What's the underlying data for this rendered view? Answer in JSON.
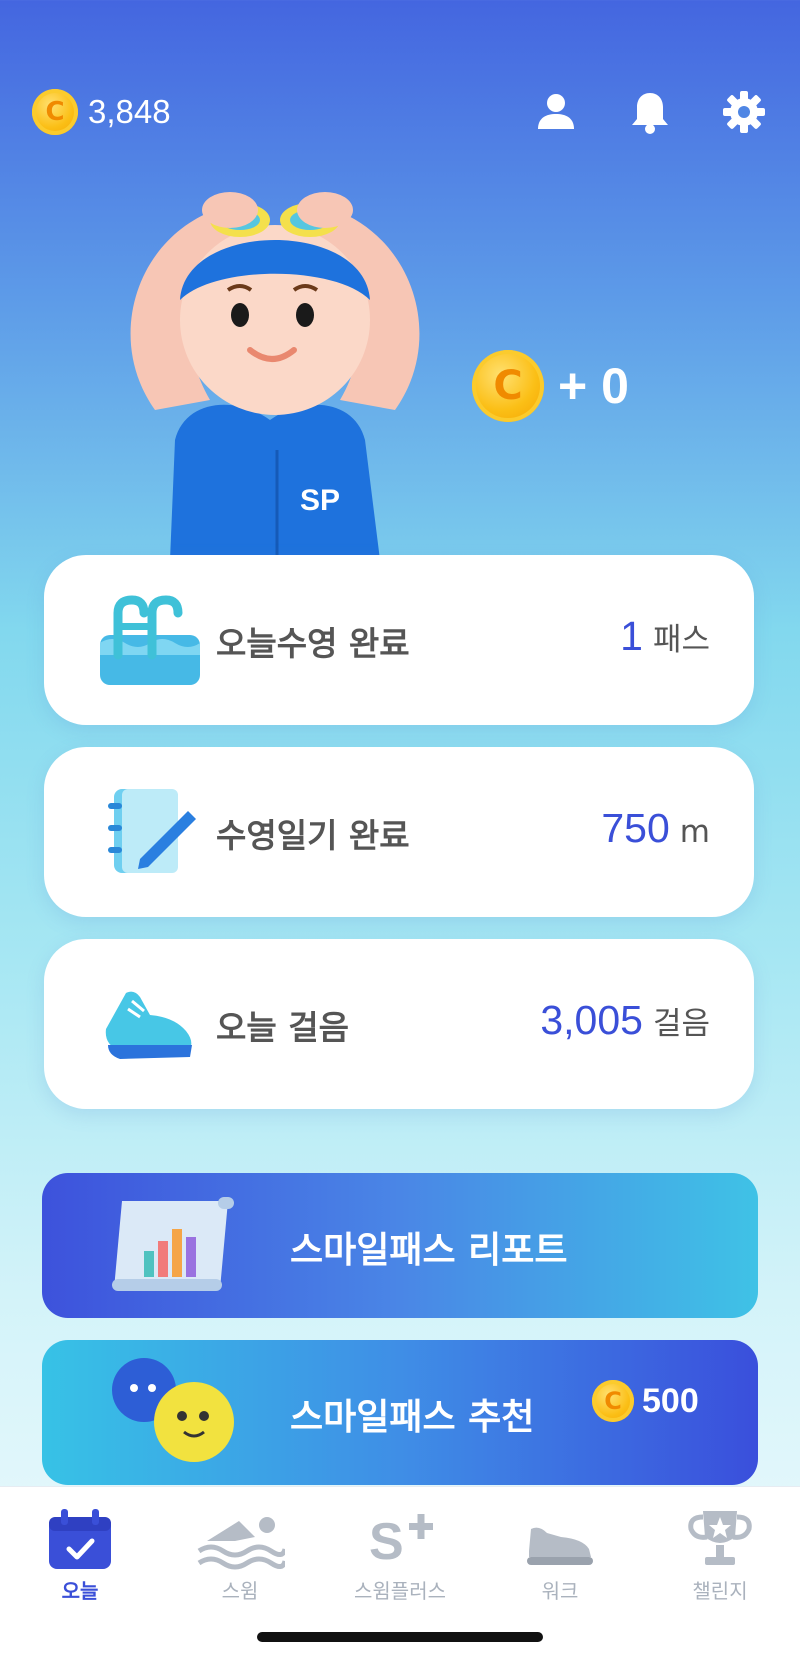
{
  "colors": {
    "accent": "#3a4fd8",
    "coin": "#fbbf16",
    "label": "#555555",
    "tab_inactive": "#aab2bd"
  },
  "header": {
    "coin_symbol": "C",
    "balance": "3,848",
    "icons": [
      "person-icon",
      "bell-icon",
      "gear-icon"
    ]
  },
  "reward": {
    "coin_symbol": "C",
    "text": "+ 0"
  },
  "stats": [
    {
      "icon": "pool-ladder-icon",
      "label": "오늘수영 완료",
      "value": "1",
      "unit": "패스"
    },
    {
      "icon": "notebook-pen-icon",
      "label": "수영일기 완료",
      "value": "750",
      "unit": "m"
    },
    {
      "icon": "sneaker-icon",
      "label": "오늘 걸음",
      "value": "3,005",
      "unit": "걸음"
    }
  ],
  "banners": {
    "report": {
      "title": "스마일패스 리포트",
      "icon": "report-chart-icon"
    },
    "recommend": {
      "title": "스마일패스 추천",
      "coin_symbol": "C",
      "amount": "500",
      "icon": "smile-balls-icon"
    }
  },
  "tabs": [
    {
      "label": "오늘",
      "icon": "calendar-check-icon",
      "active": true
    },
    {
      "label": "스윔",
      "icon": "swimmer-icon",
      "active": false
    },
    {
      "label": "스윔플러스",
      "icon": "s-plus-icon",
      "active": false
    },
    {
      "label": "워크",
      "icon": "shoe-icon",
      "active": false
    },
    {
      "label": "챌린지",
      "icon": "trophy-icon",
      "active": false
    }
  ]
}
